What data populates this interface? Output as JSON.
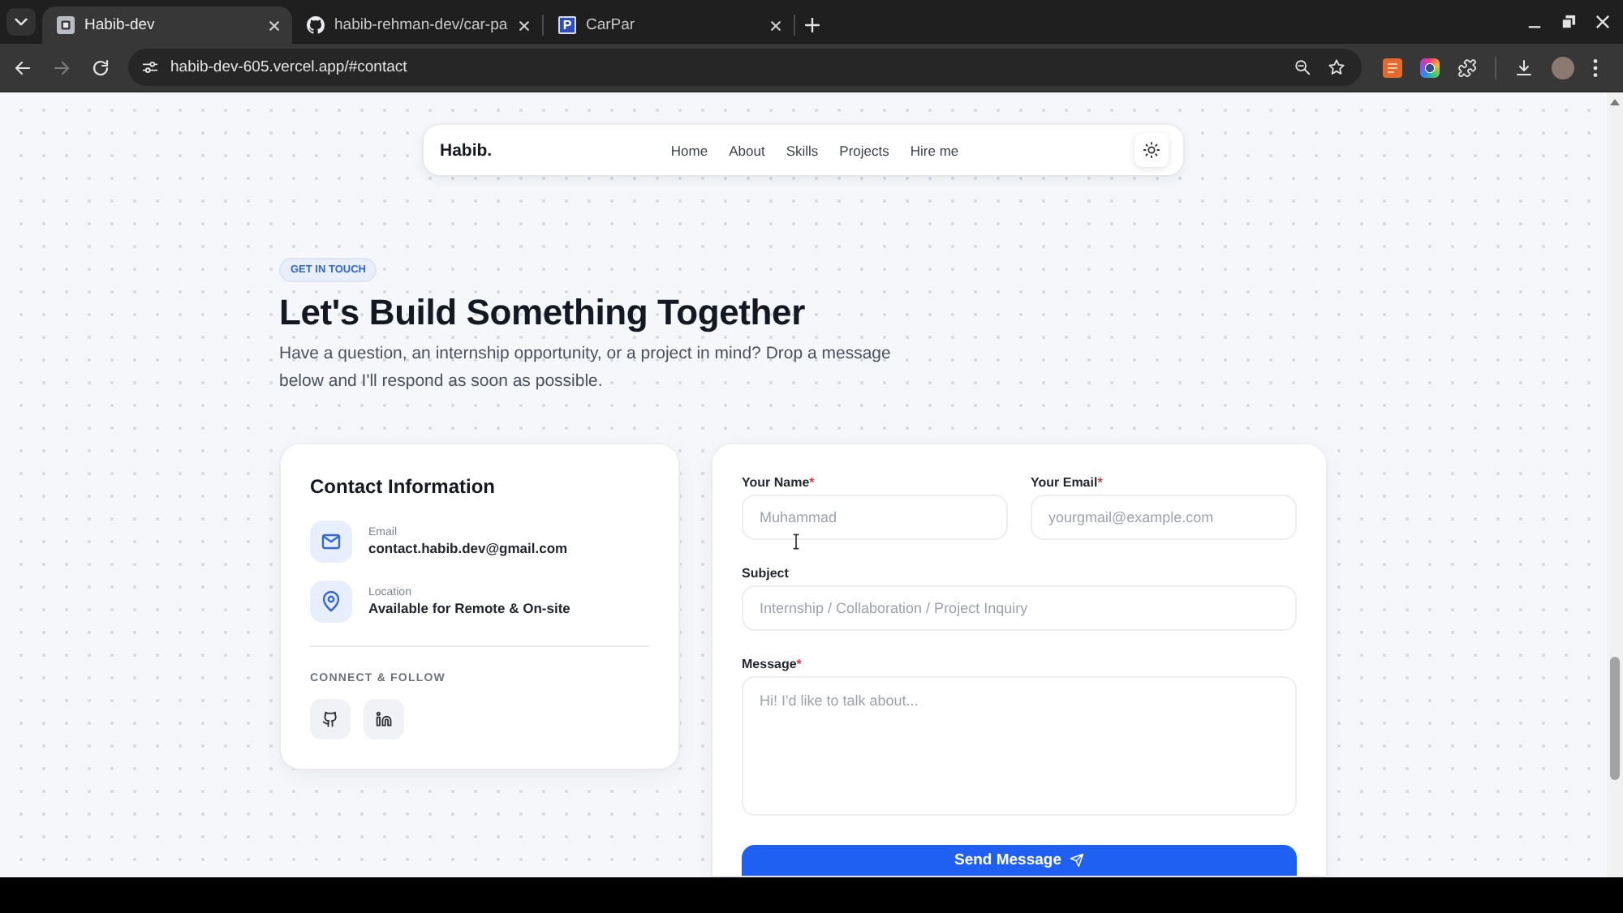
{
  "browser": {
    "tabs": [
      {
        "title": "Habib-dev",
        "kind": "page",
        "selected": true
      },
      {
        "title": "habib-rehman-dev/car-pa",
        "kind": "github",
        "selected": false
      },
      {
        "title": "CarPar",
        "kind": "letter",
        "icon_text": "P",
        "selected": false
      }
    ],
    "nav_buttons": [
      {
        "kind": "back",
        "disabled": false
      },
      {
        "kind": "forward",
        "disabled": true
      },
      {
        "kind": "reload",
        "disabled": false
      }
    ],
    "url": "habib-dev-605.vercel.app/#contact"
  },
  "navbar": {
    "logo": "Habib.",
    "links": [
      "Home",
      "About",
      "Skills",
      "Projects",
      "Hire me"
    ]
  },
  "hero": {
    "badge": "GET IN TOUCH",
    "title": "Let's Build Something Together",
    "description": "Have a question, an internship opportunity, or a project in mind? Drop a message below and I'll respond as soon as possible."
  },
  "contact_info": {
    "title": "Contact Information",
    "items": [
      {
        "kind": "email",
        "label": "Email",
        "value": "contact.habib.dev@gmail.com"
      },
      {
        "kind": "location",
        "label": "Location",
        "value": "Available for Remote & On-site"
      }
    ],
    "social_heading": "CONNECT & FOLLOW",
    "social_links": [
      {
        "kind": "github"
      },
      {
        "kind": "linkedin"
      }
    ]
  },
  "form": {
    "rows": [
      [
        {
          "kind": "input",
          "label": "Your Name",
          "required_mark": "*",
          "placeholder": "Muhammad"
        },
        {
          "kind": "input",
          "label": "Your Email",
          "required_mark": "*",
          "placeholder": "yourgmail@example.com"
        }
      ],
      [
        {
          "kind": "input",
          "label": "Subject",
          "placeholder": "Internship / Collaboration / Project Inquiry"
        }
      ],
      [
        {
          "kind": "textarea",
          "label": "Message",
          "required_mark": "*",
          "placeholder": "Hi! I'd like to talk about..."
        }
      ]
    ],
    "submit": "Send Message"
  }
}
